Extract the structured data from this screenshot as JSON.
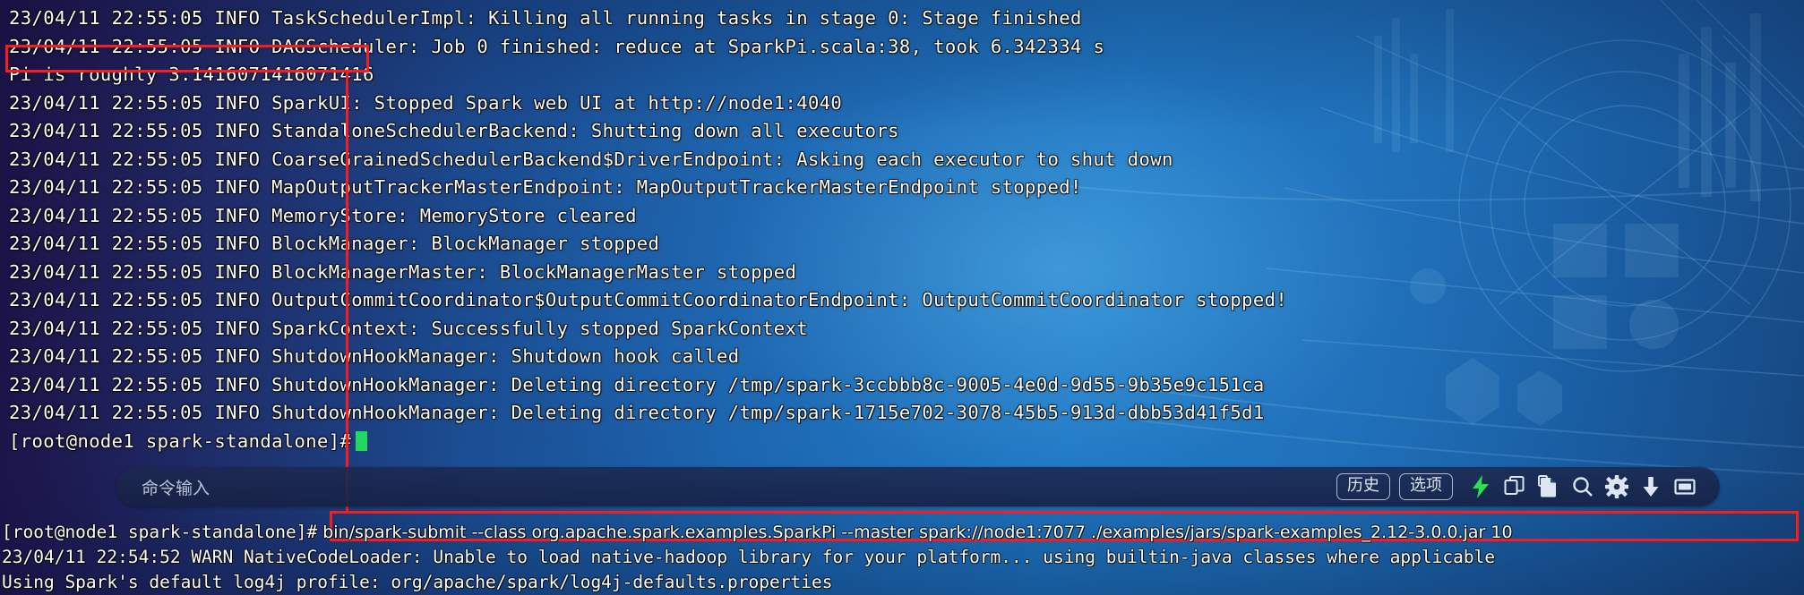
{
  "terminal": {
    "lines": [
      "23/04/11 22:55:05 INFO TaskSchedulerImpl: Killing all running tasks in stage 0: Stage finished",
      "23/04/11 22:55:05 INFO DAGScheduler: Job 0 finished: reduce at SparkPi.scala:38, took 6.342334 s",
      "Pi is roughly 3.1416071416071416",
      "23/04/11 22:55:05 INFO SparkUI: Stopped Spark web UI at http://node1:4040",
      "23/04/11 22:55:05 INFO StandaloneSchedulerBackend: Shutting down all executors",
      "23/04/11 22:55:05 INFO CoarseGrainedSchedulerBackend$DriverEndpoint: Asking each executor to shut down",
      "23/04/11 22:55:05 INFO MapOutputTrackerMasterEndpoint: MapOutputTrackerMasterEndpoint stopped!",
      "23/04/11 22:55:05 INFO MemoryStore: MemoryStore cleared",
      "23/04/11 22:55:05 INFO BlockManager: BlockManager stopped",
      "23/04/11 22:55:05 INFO BlockManagerMaster: BlockManagerMaster stopped",
      "23/04/11 22:55:05 INFO OutputCommitCoordinator$OutputCommitCoordinatorEndpoint: OutputCommitCoordinator stopped!",
      "23/04/11 22:55:05 INFO SparkContext: Successfully stopped SparkContext",
      "23/04/11 22:55:05 INFO ShutdownHookManager: Shutdown hook called",
      "23/04/11 22:55:05 INFO ShutdownHookManager: Deleting directory /tmp/spark-3ccbbb8c-9005-4e0d-9d55-9b35e9c151ca",
      "23/04/11 22:55:05 INFO ShutdownHookManager: Deleting directory /tmp/spark-1715e702-3078-45b5-913d-dbb53d41f5d1"
    ],
    "prompt": "[root@node1 spark-standalone]#"
  },
  "command_bar": {
    "placeholder": "命令输入",
    "history_label": "历史",
    "options_label": "选项",
    "icons": [
      "lightning-icon",
      "copy-icon",
      "paste-icon",
      "search-icon",
      "gear-icon",
      "download-icon",
      "fullscreen-icon"
    ]
  },
  "bottom_console": {
    "prompt": "[root@node1 spark-standalone]#",
    "command": "bin/spark-submit --class org.apache.spark.examples.SparkPi --master spark://node1:7077 ./examples/jars/spark-examples_2.12-3.0.0.jar 10",
    "lines": [
      "23/04/11 22:54:52 WARN NativeCodeLoader: Unable to load native-hadoop library for your platform... using builtin-java classes where applicable",
      "Using Spark's default log4j profile: org/apache/spark/log4j-defaults.properties"
    ]
  },
  "annotations": {
    "pi_highlight_text": "Pi is roughly 3.1416071416071416",
    "command_highlight_text": "bin/spark-submit --class org.apache.spark.examples.SparkPi --master spark://node1:7077 ./examples/jars/spark-examples_2.12-3.0.0.jar 10",
    "color": "#f51d1d"
  },
  "colors": {
    "cursor": "#21d861",
    "lightning": "#2ae04f",
    "text": "#ffffff"
  }
}
